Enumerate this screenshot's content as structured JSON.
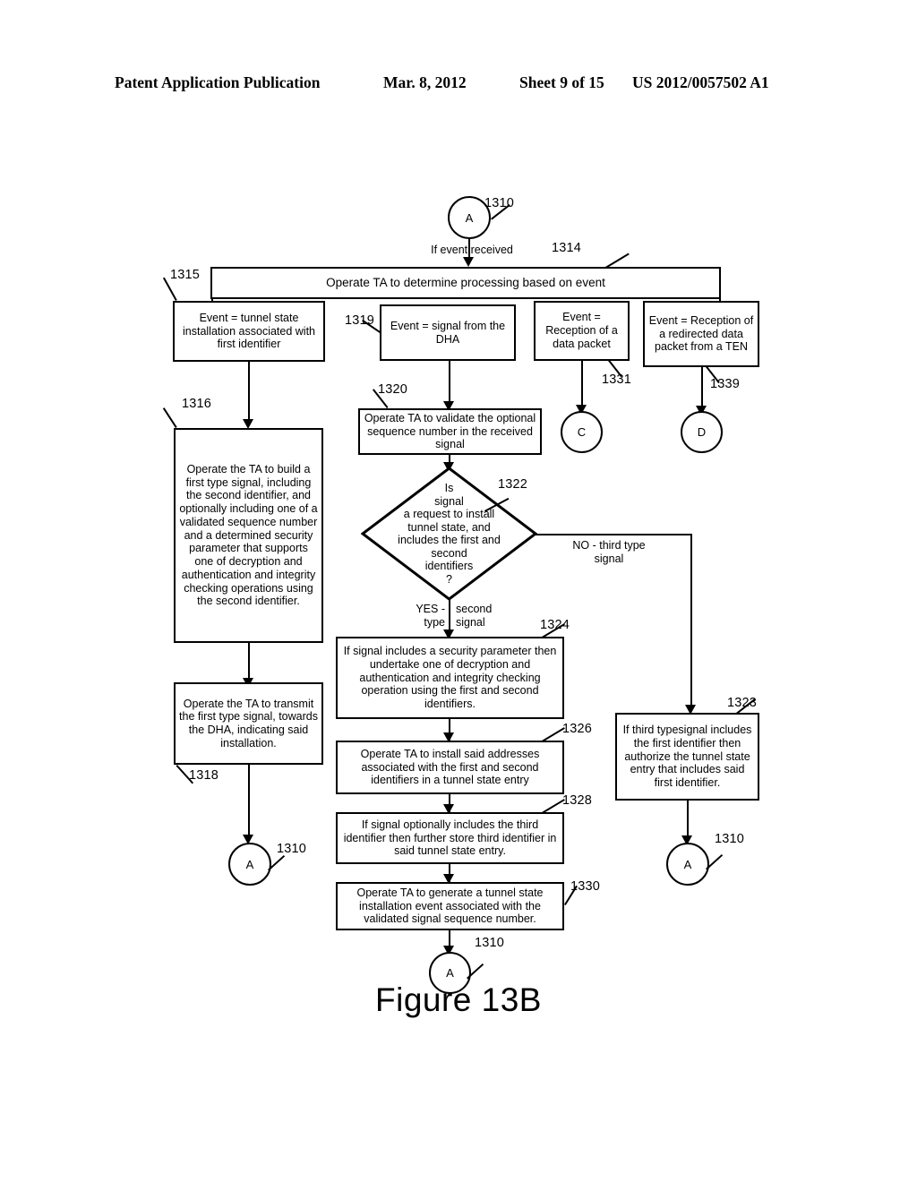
{
  "header": {
    "publication": "Patent Application Publication",
    "date": "Mar. 8, 2012",
    "sheet": "Sheet 9 of 15",
    "patent_number": "US 2012/0057502 A1"
  },
  "figure": {
    "caption": "Figure 13B"
  },
  "connectors": {
    "a_top": "A",
    "a_left_bottom": "A",
    "a_center_bottom": "A",
    "a_right_bottom": "A",
    "c": "C",
    "d": "D"
  },
  "nodes": {
    "n1314": "Operate TA to determine processing based on event",
    "n1315": "Event = tunnel state installation associated with first identifier",
    "n1319": "Event = signal from the DHA",
    "n1331": "Event = Reception of a data packet",
    "n1339": "Event = Reception of a redirected data packet from a TEN",
    "n1316": "Operate the TA to build a first type signal, including the second identifier, and optionally including one of a validated sequence number and a determined security parameter that supports one of decryption and authentication and integrity checking operations using the second identifier.",
    "n1318": "Operate the TA to transmit the first type signal, towards the DHA, indicating said installation.",
    "n1320": "Operate TA to validate the optional sequence number in the received signal",
    "n1322": "Is\nsignal\na request to install\ntunnel state, and\nincludes the first and\nsecond\nidentifiers\n?",
    "n1324": "If signal includes a security parameter then undertake one of decryption and authentication and integrity checking operation using the first and second identifiers.",
    "n1326": "Operate TA to install said addresses associated with the first and second identifiers in a tunnel state entry",
    "n1328": "If signal optionally includes the third identifier then further store third identifier in said tunnel state entry.",
    "n1330": "Operate TA to generate a tunnel state installation event associated with the validated signal sequence number.",
    "n1323": "If third typesignal includes the first identifier then authorize the tunnel state entry that includes said first identifier."
  },
  "edge_labels": {
    "if_event_received": "If event received",
    "yes_branch": "YES -\ntype",
    "yes_branch_right": "second\nsignal",
    "no_branch": "NO - third type\nsignal"
  },
  "ref_numbers": {
    "r1310_top": "1310",
    "r1314": "1314",
    "r1315": "1315",
    "r1319": "1319",
    "r1331": "1331",
    "r1339": "1339",
    "r1316": "1316",
    "r1318": "1318",
    "r1320": "1320",
    "r1322": "1322",
    "r1323": "1323",
    "r1324": "1324",
    "r1326": "1326",
    "r1328": "1328",
    "r1330": "1330",
    "r1310_left": "1310",
    "r1310_center": "1310",
    "r1310_right": "1310"
  }
}
